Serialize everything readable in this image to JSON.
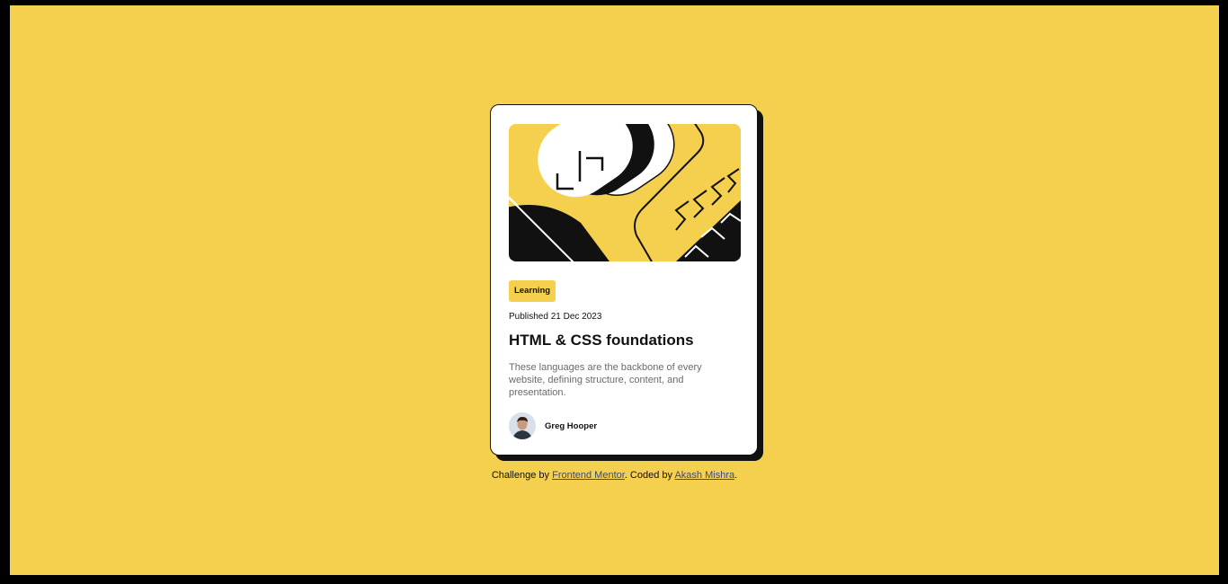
{
  "card": {
    "tag": "Learning",
    "published": "Published 21 Dec 2023",
    "title": "HTML & CSS foundations",
    "description": "These languages are the backbone of every website, defining structure, content, and presentation.",
    "author": "Greg Hooper"
  },
  "footer": {
    "prefix": "Challenge by ",
    "link1": "Frontend Mentor",
    "middle": ". Coded by ",
    "link2": "Akash Mishra",
    "suffix": "."
  },
  "colors": {
    "background": "#f4d04e",
    "card": "#ffffff",
    "ink": "#111111",
    "muted_text": "#6b6b6b",
    "link": "#3b4a78"
  },
  "icons": {
    "hero": "html-css-illustration",
    "avatar": "greg-hooper-avatar"
  }
}
